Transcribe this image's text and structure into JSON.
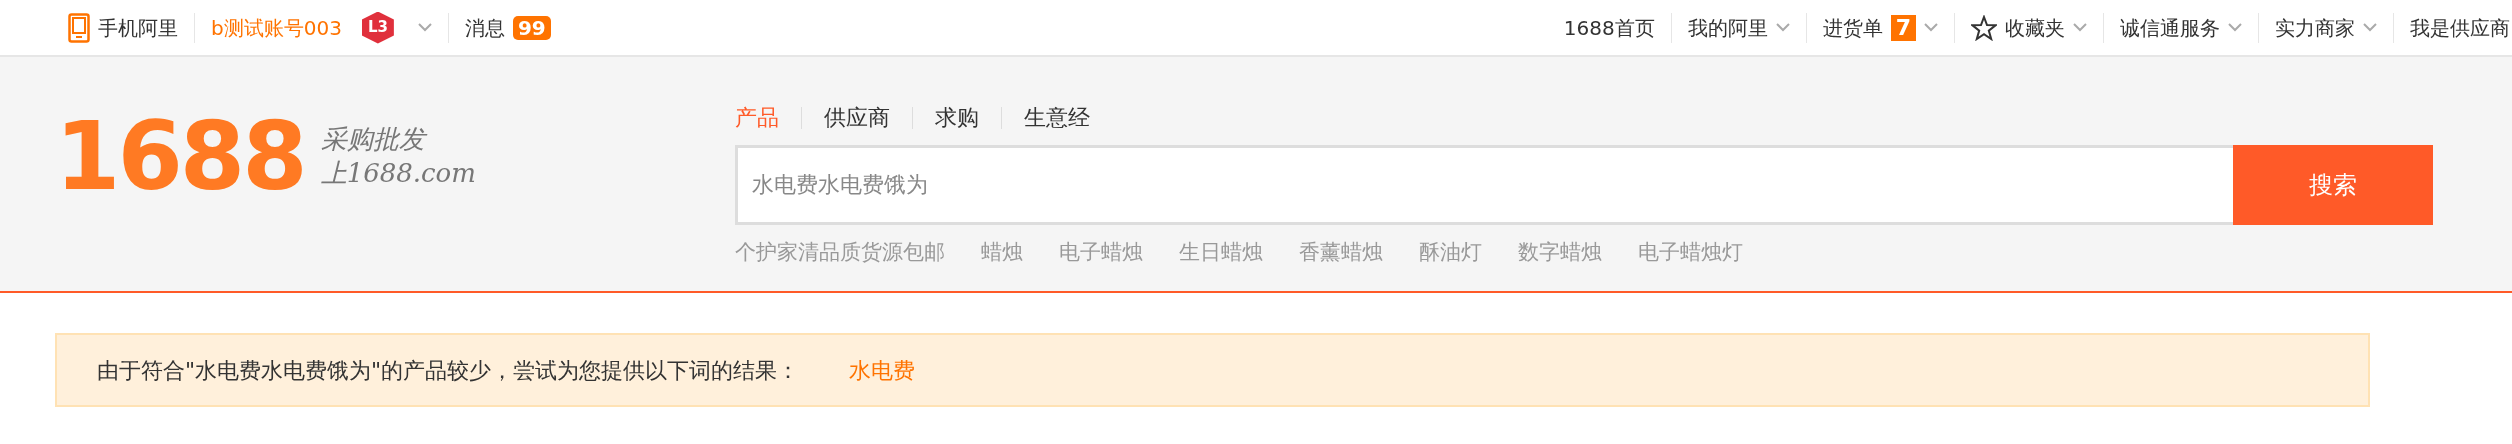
{
  "top_bar": {
    "left": [
      {
        "kind": "mobile",
        "label": "手机阿里"
      },
      {
        "kind": "account",
        "label": "b测试账号003",
        "level_badge": "L3",
        "has_menu": true
      },
      {
        "kind": "messages",
        "label": "消息",
        "badge": "99"
      }
    ],
    "right": [
      {
        "label": "1688首页",
        "has_menu": false
      },
      {
        "label": "我的阿里",
        "has_menu": true
      },
      {
        "label": "进货单",
        "badge": "7",
        "has_menu": true
      },
      {
        "label": "收藏夹",
        "kind": "favorites",
        "has_menu": true
      },
      {
        "label": "诚信通服务",
        "has_menu": true
      },
      {
        "label": "实力商家",
        "has_menu": true
      },
      {
        "label": "我是供应商",
        "has_menu": false
      }
    ]
  },
  "logo": {
    "number": "1688",
    "slogan": "采购批发",
    "tagline": "上1688.com"
  },
  "search": {
    "tabs": [
      {
        "label": "产品",
        "selected": true
      },
      {
        "label": "供应商",
        "selected": false
      },
      {
        "label": "求购",
        "selected": false
      },
      {
        "label": "生意经",
        "selected": false
      }
    ],
    "value": "水电费水电费饿为",
    "button": "搜索",
    "suggestions": [
      "个护家清品质货源包邮",
      "蜡烛",
      "电子蜡烛",
      "生日蜡烛",
      "香薰蜡烛",
      "酥油灯",
      "数字蜡烛",
      "电子蜡烛灯"
    ]
  },
  "notice": {
    "text": "由于符合\"水电费水电费饿为\"的产品较少，尝试为您提供以下词的结果：",
    "link": "水电费"
  }
}
